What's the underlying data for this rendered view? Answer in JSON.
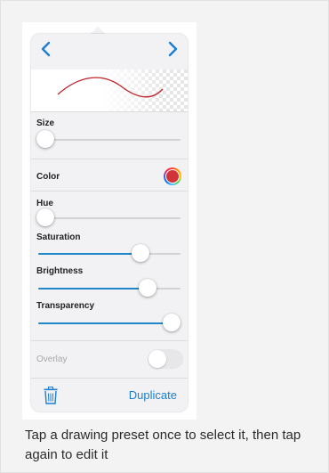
{
  "panel": {
    "nav": {
      "prev_icon": "chevron-left-icon",
      "next_icon": "chevron-right-icon"
    },
    "preview": {
      "stroke_color": "#c0262d"
    },
    "size": {
      "label": "Size",
      "value": 0.05
    },
    "color": {
      "label": "Color",
      "swatch_color": "#d0343a"
    },
    "hue": {
      "label": "Hue",
      "value": 0.05
    },
    "saturation": {
      "label": "Saturation",
      "value": 0.72
    },
    "brightness": {
      "label": "Brightness",
      "value": 0.77
    },
    "transparency": {
      "label": "Transparency",
      "value": 0.94
    },
    "overlay": {
      "label": "Overlay",
      "enabled": false
    },
    "toolbar": {
      "trash_icon": "trash-icon",
      "duplicate_label": "Duplicate"
    }
  },
  "caption": "Tap a drawing preset once to select it, then tap again to edit it",
  "colors": {
    "accent": "#1a7fd0",
    "slider_fill": "#1f86c7"
  }
}
